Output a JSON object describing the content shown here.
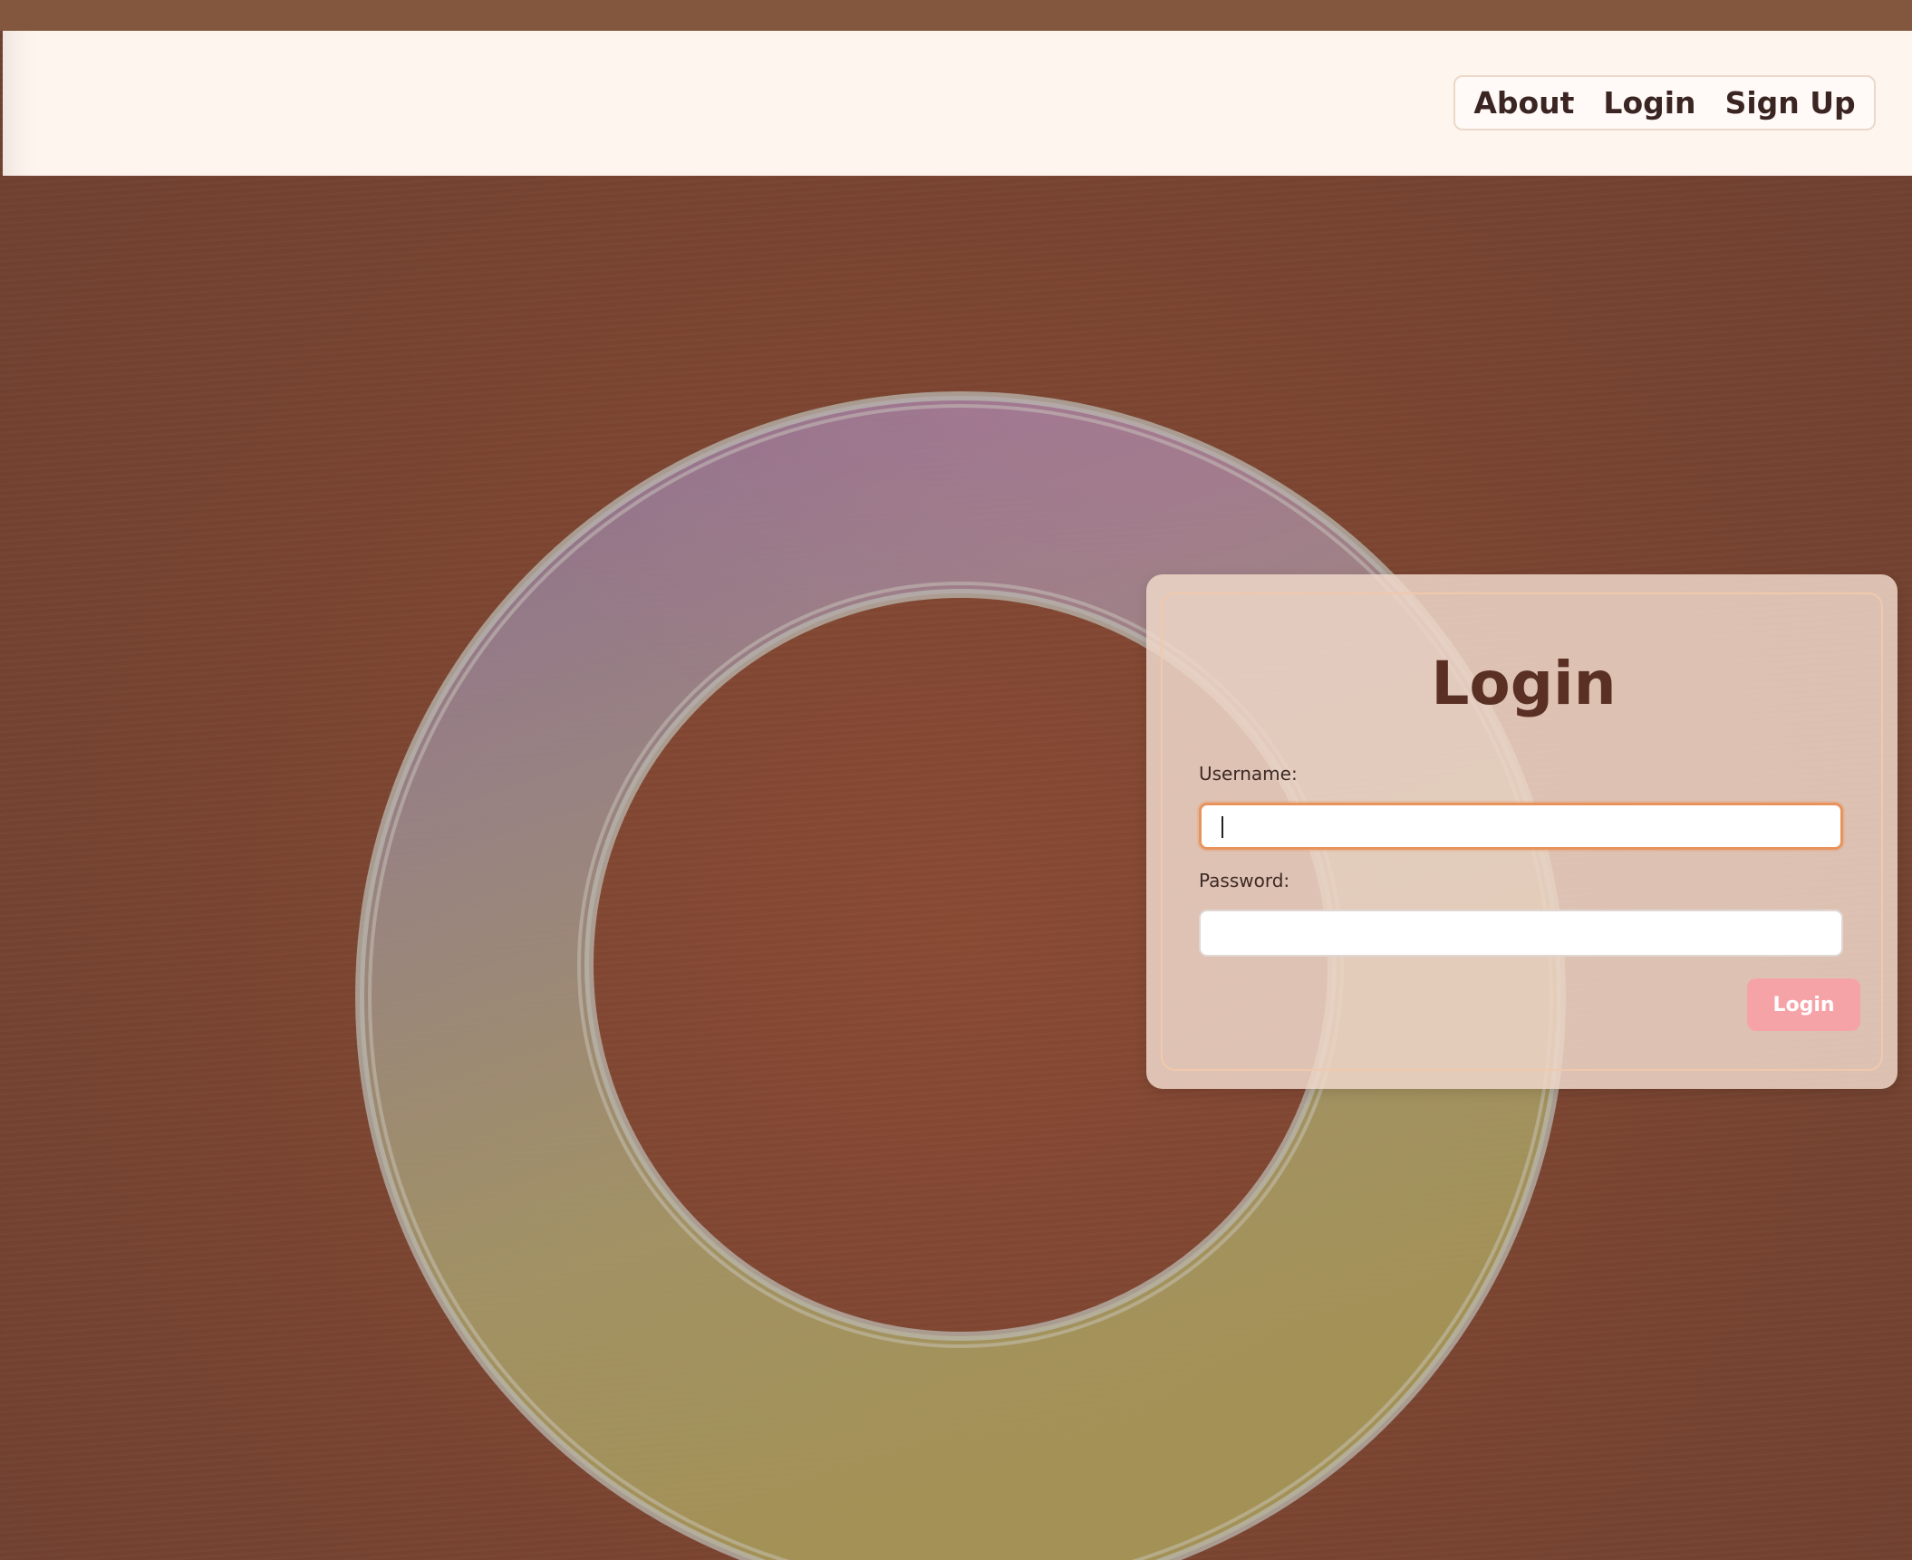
{
  "nav": {
    "items": [
      {
        "label": "About"
      },
      {
        "label": "Login"
      },
      {
        "label": "Sign Up"
      }
    ]
  },
  "login_form": {
    "title": "Login",
    "username_label": "Username:",
    "username_value": "",
    "password_label": "Password:",
    "password_value": "",
    "submit_label": "Login"
  },
  "colors": {
    "background": "#7a4a33",
    "header": "#fff5ef",
    "title_text": "#5a3024",
    "button": "#f6a3a8",
    "focus_ring": "#e8935c"
  }
}
